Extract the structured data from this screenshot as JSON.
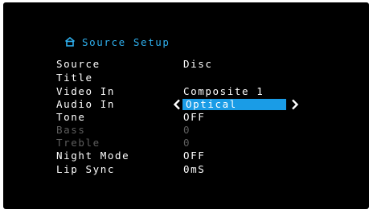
{
  "menu": {
    "title": "Source Setup",
    "title_icon": "home-icon",
    "accent_color": "#1a9ce6",
    "title_color": "#2fb0ee",
    "dim_color": "#5e5e5e",
    "items": [
      {
        "label": "Source",
        "value": "Disc"
      },
      {
        "label": "Title",
        "value": ""
      },
      {
        "label": "Video In",
        "value": "Composite 1"
      },
      {
        "label": "Audio In",
        "value": "Optical"
      },
      {
        "label": "Tone",
        "value": "OFF"
      },
      {
        "label": "Bass",
        "value": "0"
      },
      {
        "label": "Treble",
        "value": "0"
      },
      {
        "label": "Night Mode",
        "value": "OFF"
      },
      {
        "label": "Lip Sync",
        "value": "0mS"
      }
    ]
  }
}
